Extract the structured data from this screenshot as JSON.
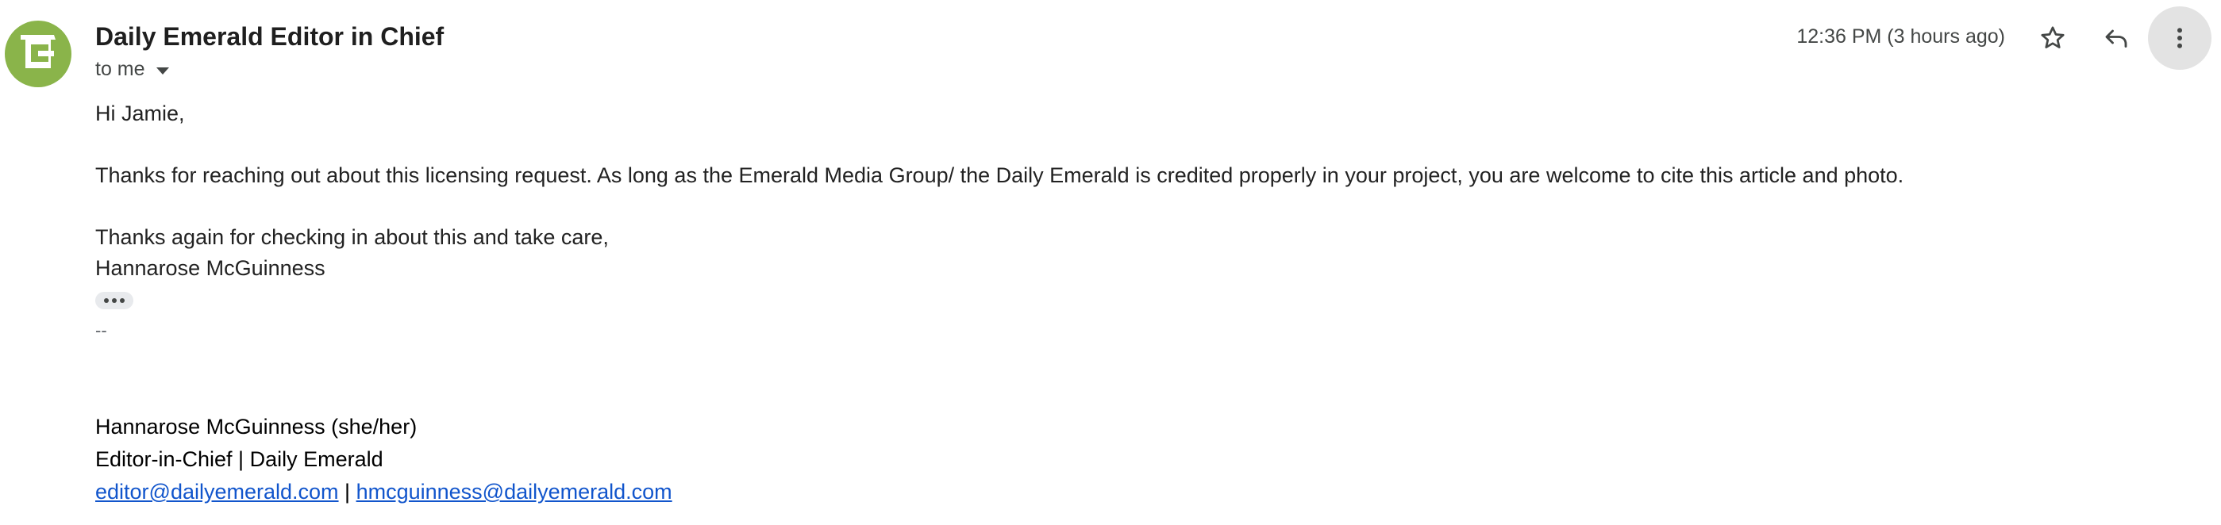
{
  "sender": {
    "name": "Daily Emerald Editor in Chief",
    "recipient_label": "to me",
    "avatar_color": "#8ab44a",
    "avatar_icon": "emerald-logo"
  },
  "meta": {
    "timestamp": "12:36 PM (3 hours ago)"
  },
  "actions": {
    "star_icon": "star-outline",
    "reply_icon": "reply-arrow",
    "more_icon": "vertical-dots"
  },
  "body": {
    "greeting": "Hi Jamie,",
    "paragraph": "Thanks for reaching out about this licensing request. As long as the Emerald Media Group/ the Daily Emerald is credited properly in your project, you are welcome to cite this article and photo.",
    "closing": "Thanks again for checking in about this and take care,",
    "signoff_name": "Hannarose McGuinness"
  },
  "signature": {
    "separator": "--",
    "name_line": "Hannarose McGuinness (she/her)",
    "title_line": "Editor-in-Chief | Daily Emerald",
    "email_1": "editor@dailyemerald.com",
    "pipe": " | ",
    "email_2": "hmcguinness@dailyemerald.com",
    "link_color": "#1155cc"
  }
}
